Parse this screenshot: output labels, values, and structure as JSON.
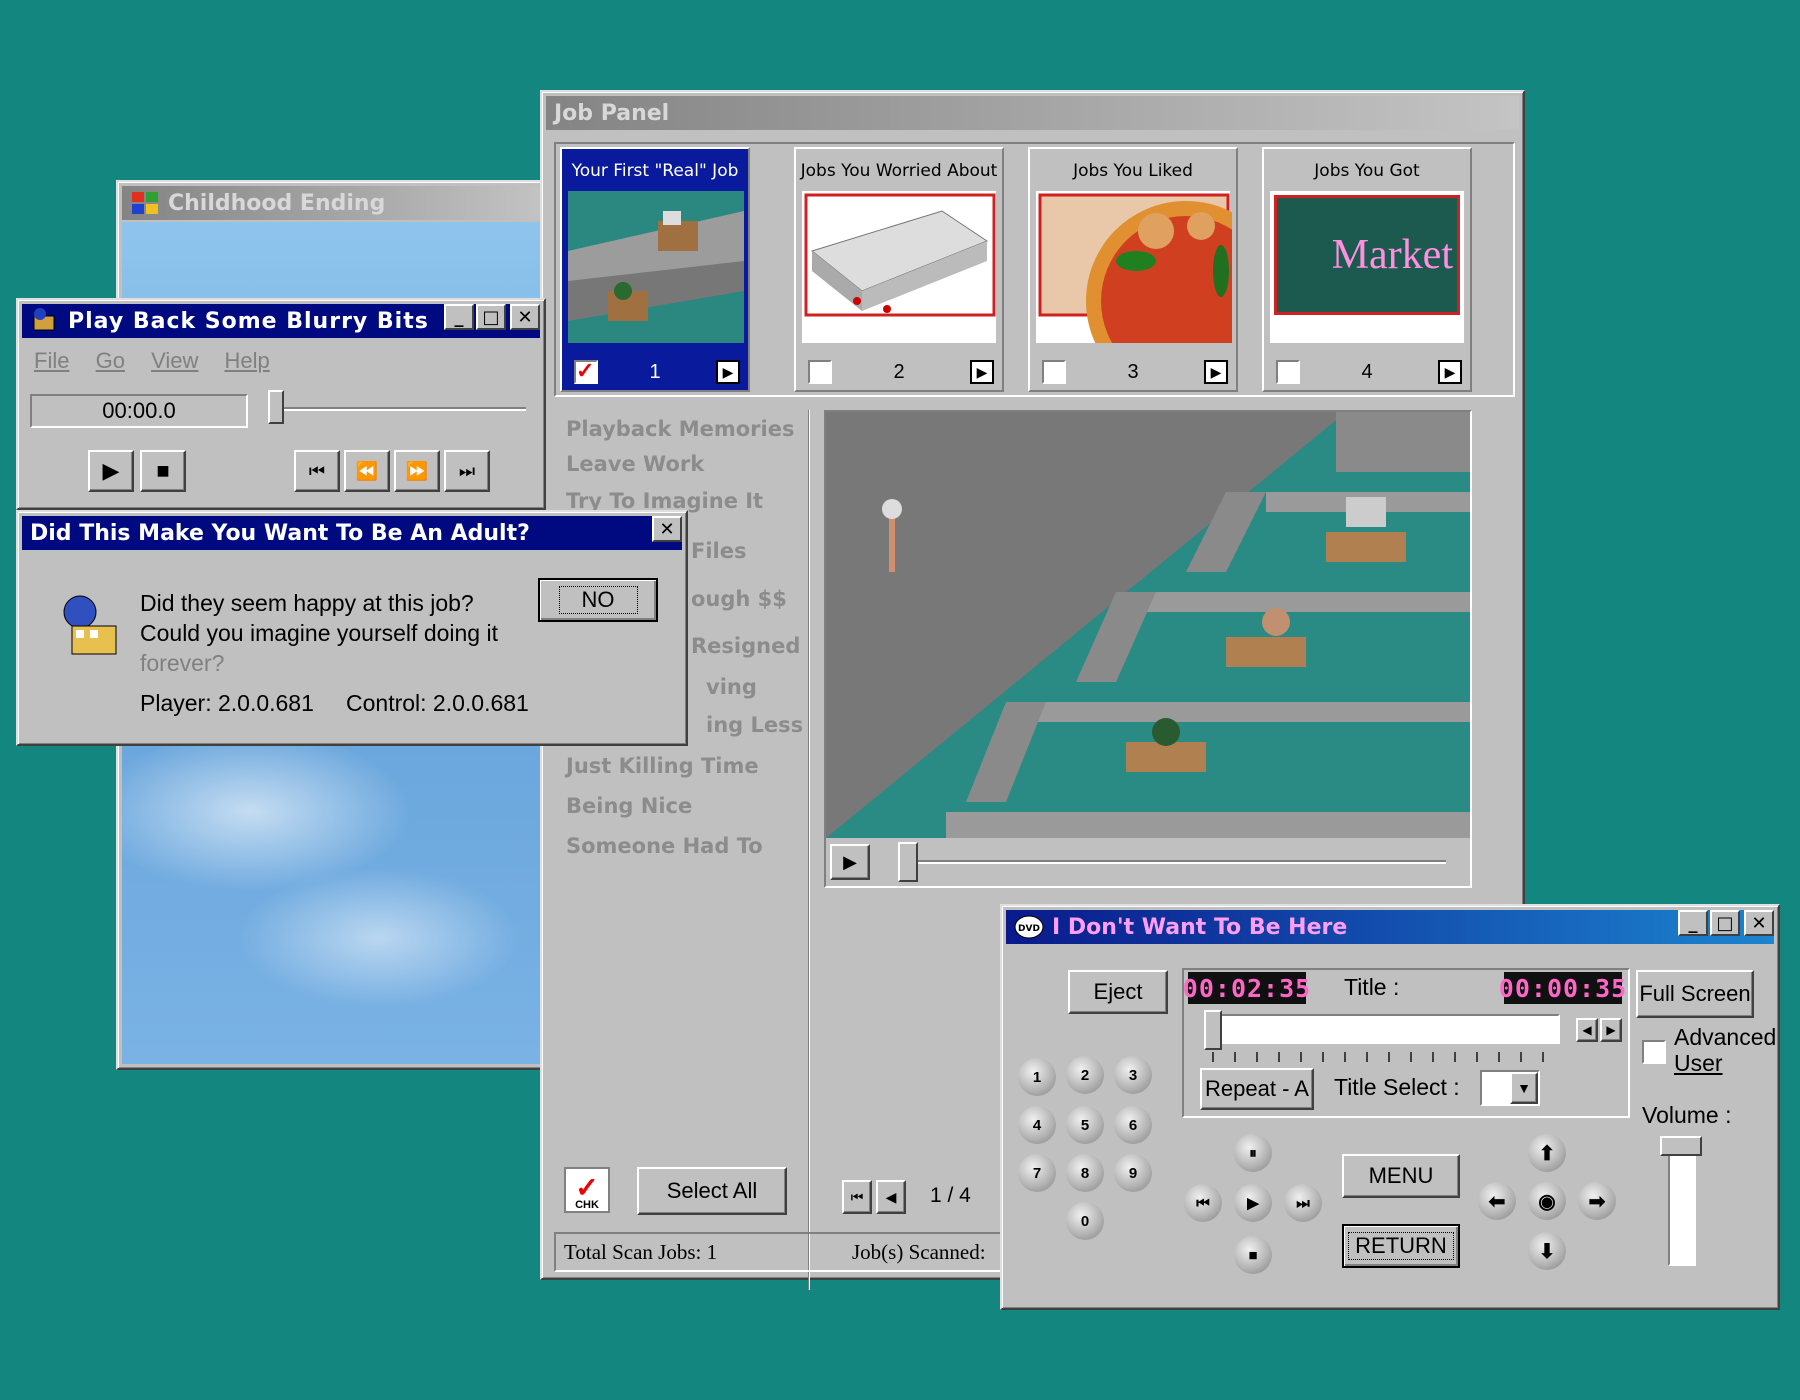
{
  "colors": {
    "desktop": "#138680",
    "title_active": "#000a80",
    "lcd_text": "#ff66c8"
  },
  "childhood": {
    "title": "Childhood Ending",
    "icon": "windows-logo-icon"
  },
  "playback": {
    "title": "Play Back Some Blurry Bits",
    "menu": [
      "File",
      "Go",
      "View",
      "Help"
    ],
    "time": "00:00.0",
    "seek_fraction": 0.0
  },
  "dialog": {
    "title": "Did This Make You Want To Be An Adult?",
    "line1": "Did they seem happy at this job?",
    "line2": "Could you imagine yourself doing it",
    "line3": "forever?",
    "player": "Player:  2.0.0.681",
    "control": "Control: 2.0.0.681",
    "no_button": "NO"
  },
  "jobpanel": {
    "title": "Job Panel",
    "tabs": [
      {
        "label": "Your First \"Real\" Job",
        "num": "1",
        "checked": true
      },
      {
        "label": "Jobs You Worried About",
        "num": "2",
        "checked": false
      },
      {
        "label": "Jobs You Liked",
        "num": "3",
        "checked": false
      },
      {
        "label": "Jobs You Got",
        "num": "4",
        "checked": false
      }
    ],
    "market_text": "Market",
    "list": [
      "Playback Memories",
      "Leave Work",
      "Try To Imagine It",
      "Files",
      "ough $$",
      "Resigned",
      "ving",
      "ing Less",
      "Just Killing Time",
      "Being Nice",
      "Someone Had To"
    ],
    "select_all": "Select All",
    "chk_label": "CHK",
    "page": "1 / 4",
    "total_scan": "Total Scan Jobs:  1",
    "scanned": "Job(s) Scanned:"
  },
  "dvd": {
    "title": "I Don't Want To Be Here",
    "eject": "Eject",
    "time_left": "00:02:35",
    "title_label": "Title :",
    "time_right": "00:00:35",
    "fullscreen": "Full Screen",
    "advanced": "Advanced",
    "user": "User",
    "repeat": "Repeat - A",
    "title_select": "Title Select :",
    "volume": "Volume :",
    "menu": "MENU",
    "return": "RETURN",
    "keypad": [
      "1",
      "2",
      "3",
      "4",
      "5",
      "6",
      "7",
      "8",
      "9",
      "0"
    ]
  }
}
